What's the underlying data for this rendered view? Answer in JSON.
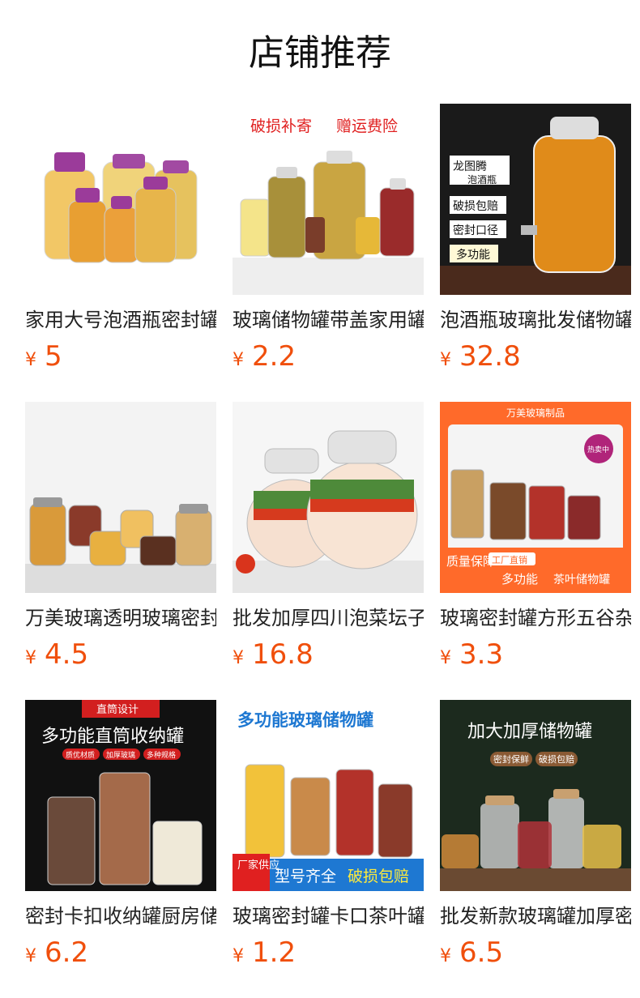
{
  "page_title": "店铺推荐",
  "currency_symbol": "¥",
  "colors": {
    "price": "#f04f0c",
    "title": "#111111",
    "text": "#222222"
  },
  "products": [
    {
      "name": "家用大号泡酒瓶密封罐",
      "price": "5",
      "image_overlay": []
    },
    {
      "name": "玻璃储物罐带盖家用罐",
      "price": "2.2",
      "image_overlay": [
        "破损补寄",
        "赠运费险"
      ]
    },
    {
      "name": "泡酒瓶玻璃批发储物罐",
      "price": "32.8",
      "image_overlay": [
        "龙图腾",
        "泡酒瓶",
        "破损包赔",
        "密封口径",
        "多功能"
      ]
    },
    {
      "name": "万美玻璃透明玻璃密封罐",
      "price": "4.5",
      "image_overlay": []
    },
    {
      "name": "批发加厚四川泡菜坛子",
      "price": "16.8",
      "image_overlay": []
    },
    {
      "name": "玻璃密封罐方形五谷杂粮",
      "price": "3.3",
      "image_overlay": [
        "万美玻璃制品",
        "热卖中",
        "质量保障",
        "工厂直销",
        "多功能",
        "茶叶储物罐"
      ]
    },
    {
      "name": "密封卡扣收纳罐厨房储物",
      "price": "6.2",
      "image_overlay": [
        "直筒设计",
        "多功能直筒收纳罐",
        "质优材质",
        "加厚玻璃",
        "多种规格"
      ]
    },
    {
      "name": "玻璃密封罐卡口茶叶罐",
      "price": "1.2",
      "image_overlay": [
        "多功能玻璃储物罐",
        "厂家供应",
        "型号齐全",
        "破损包赔"
      ]
    },
    {
      "name": "批发新款玻璃罐加厚密封",
      "price": "6.5",
      "image_overlay": [
        "加大加厚储物罐",
        "密封保鲜",
        "破损包赔"
      ]
    }
  ]
}
